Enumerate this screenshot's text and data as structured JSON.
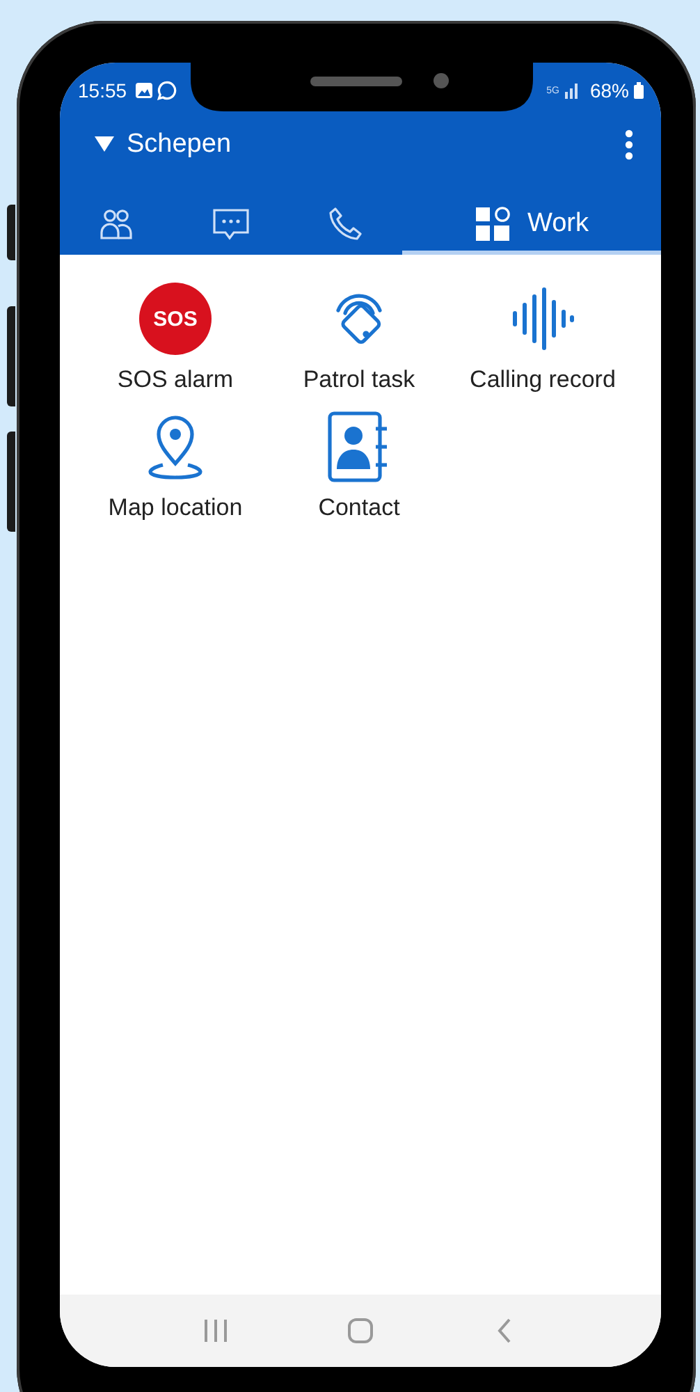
{
  "status_bar": {
    "time": "15:55",
    "network": "5G",
    "battery": "68%"
  },
  "app_bar": {
    "title": "Schepen"
  },
  "tabs": [
    {
      "selected": false
    },
    {
      "selected": false
    },
    {
      "selected": false
    },
    {
      "label": "Work",
      "selected": true
    }
  ],
  "apps": [
    {
      "label": "SOS alarm",
      "badge": "SOS"
    },
    {
      "label": "Patrol task"
    },
    {
      "label": "Calling record"
    },
    {
      "label": "Map location"
    },
    {
      "label": "Contact"
    }
  ]
}
